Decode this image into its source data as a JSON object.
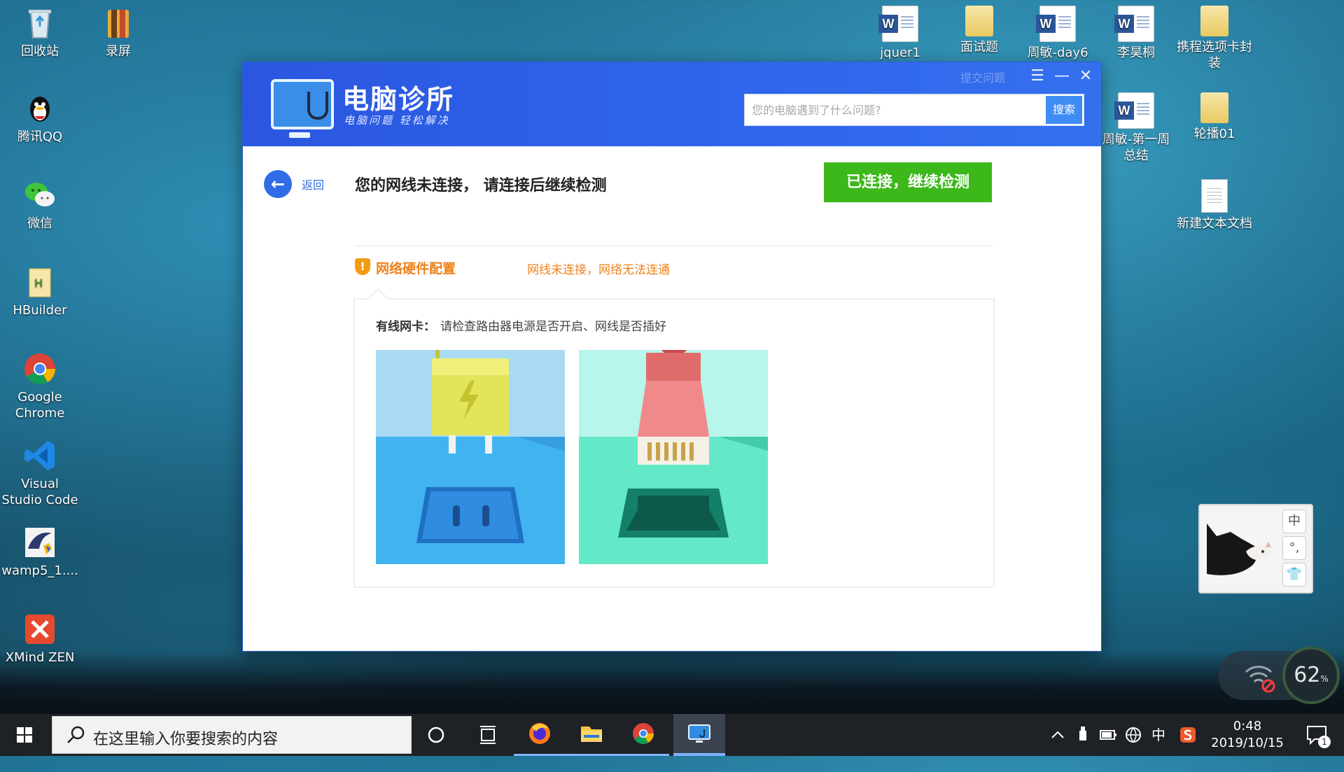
{
  "desktop": {
    "left_icons": [
      {
        "label": "回收站",
        "icon": "recycle-bin-icon"
      },
      {
        "label": "录屏",
        "icon": "screen-record-icon"
      },
      {
        "label": "腾讯QQ",
        "icon": "qq-icon"
      },
      {
        "label": "微信",
        "icon": "wechat-icon"
      },
      {
        "label": "HBuilder",
        "icon": "hbuilder-icon"
      },
      {
        "label": "Google Chrome",
        "icon": "chrome-icon"
      },
      {
        "label": "Visual Studio Code",
        "icon": "vscode-icon"
      },
      {
        "label": "wamp5_1....",
        "icon": "wamp-icon"
      },
      {
        "label": "XMind ZEN",
        "icon": "xmind-icon"
      }
    ],
    "right_icons": [
      {
        "label": "jquer1",
        "icon": "word-doc-icon"
      },
      {
        "label": "面试题",
        "icon": "folder-icon"
      },
      {
        "label": "周敏-day6",
        "icon": "word-doc-icon"
      },
      {
        "label": "李昊桐",
        "icon": "word-doc-icon"
      },
      {
        "label": "携程选项卡封装",
        "icon": "folder-icon"
      },
      {
        "label": "周敏-第一周总结",
        "icon": "word-doc-icon"
      },
      {
        "label": "轮播01",
        "icon": "folder-icon"
      },
      {
        "label": "新建文本文档",
        "icon": "text-file-icon"
      }
    ]
  },
  "app": {
    "brand_title": "电脑诊所",
    "brand_subtitle": "电脑问题 轻松解决",
    "submit_question": "提交问题",
    "search_placeholder": "您的电脑遇到了什么问题?",
    "search_button": "搜索",
    "back_label": "返回",
    "status_message": "您的网线未连接， 请连接后继续检测",
    "continue_button": "已连接，继续检测",
    "section_title": "网络硬件配置",
    "section_status": "网线未连接，网络无法连通",
    "nic_label": "有线网卡：",
    "nic_text": "请检查路由器电源是否开启、网线是否插好"
  },
  "widget": {
    "buttons": [
      "中",
      "°,",
      "👕"
    ]
  },
  "network_meter": {
    "percent": "62",
    "unit": "%"
  },
  "taskbar": {
    "search_placeholder": "在这里输入你要搜索的内容",
    "time": "0:48",
    "date": "2019/10/15",
    "ime": "中",
    "notifications": "1"
  },
  "colors": {
    "header_blue": "#2f66ec",
    "continue_green": "#3cb81a",
    "warning_orange": "#f0821a"
  }
}
